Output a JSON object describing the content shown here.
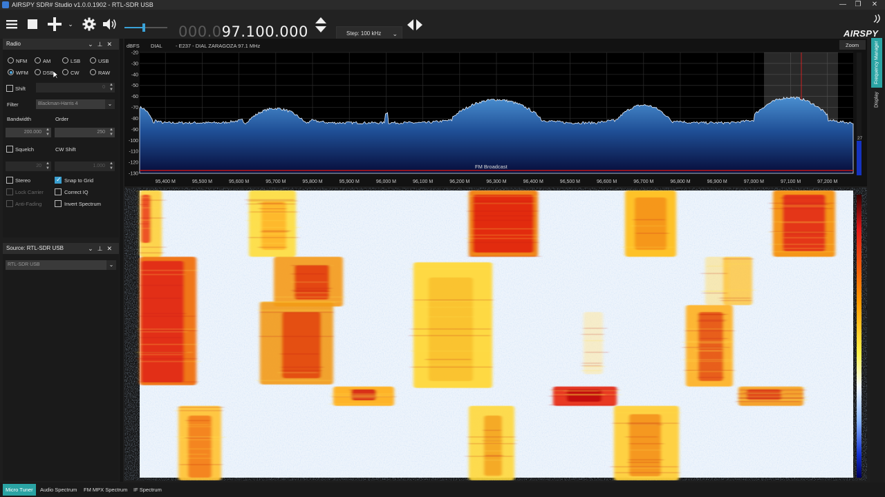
{
  "window": {
    "title": "AIRSPY SDR# Studio v1.0.0.1902 - RTL-SDR USB",
    "controls": [
      "—",
      "❐",
      "✕"
    ]
  },
  "toolbar": {
    "menu_icon": "hamburger-menu-icon",
    "stop_icon": "stop-icon",
    "add_icon": "plus-icon",
    "settings_icon": "gear-icon",
    "audio_icon": "speaker-icon",
    "volume": 0.45,
    "frequency_dim": "000.0",
    "frequency_bright": "97.100.000",
    "step_label": "Step: 100 kHz",
    "logo": "AIRSPY"
  },
  "radio_panel": {
    "title": "Radio",
    "modes": [
      {
        "label": "NFM",
        "selected": false
      },
      {
        "label": "AM",
        "selected": false
      },
      {
        "label": "LSB",
        "selected": false
      },
      {
        "label": "USB",
        "selected": false
      },
      {
        "label": "WFM",
        "selected": true
      },
      {
        "label": "DSB",
        "selected": false
      },
      {
        "label": "CW",
        "selected": false
      },
      {
        "label": "RAW",
        "selected": false
      }
    ],
    "shift_label": "Shift",
    "shift_value": "0",
    "filter_label": "Filter",
    "filter_value": "Blackman-Harris 4",
    "bandwidth_label": "Bandwidth",
    "bandwidth_value": "200.000",
    "order_label": "Order",
    "order_value": "250",
    "squelch_label": "Squelch",
    "cw_shift_label": "CW Shift",
    "squelch_value": "20",
    "cw_shift_value": "1.000",
    "stereo_label": "Stereo",
    "snap_label": "Snap to Grid",
    "lock_carrier_label": "Lock Carrier",
    "correct_iq_label": "Correct IQ",
    "anti_fading_label": "Anti-Fading",
    "invert_label": "Invert Spectrum"
  },
  "source_panel": {
    "title": "Source: RTL-SDR USB",
    "device": "RTL-SDR USB"
  },
  "spectrum": {
    "unit": "dBFS",
    "dial_label": "DIAL",
    "station_text": "- E237 - DIAL ZARAGOZA 97.1 MHz",
    "band_label": "FM Broadcast",
    "zoom_label": "Zoom",
    "db_ticks": [
      "-20",
      "-30",
      "-40",
      "-50",
      "-60",
      "-70",
      "-80",
      "-90",
      "-100",
      "-110",
      "-120",
      "-130"
    ],
    "freq_ticks": [
      "95,400 M",
      "95,500 M",
      "95,600 M",
      "95,700 M",
      "95,800 M",
      "95,900 M",
      "96,000 M",
      "96,100 M",
      "96,200 M",
      "96,300 M",
      "96,400 M",
      "96,500 M",
      "96,600 M",
      "96,700 M",
      "96,800 M",
      "96,900 M",
      "97,000 M",
      "97,100 M",
      "97,200 M"
    ],
    "level_readout": "27"
  },
  "side_tabs": [
    "Frequency Manager",
    "Display"
  ],
  "bottom_tabs": [
    "Micro Tuner",
    "Audio Spectrum",
    "FM MPX Spectrum",
    "IF Spectrum"
  ]
}
